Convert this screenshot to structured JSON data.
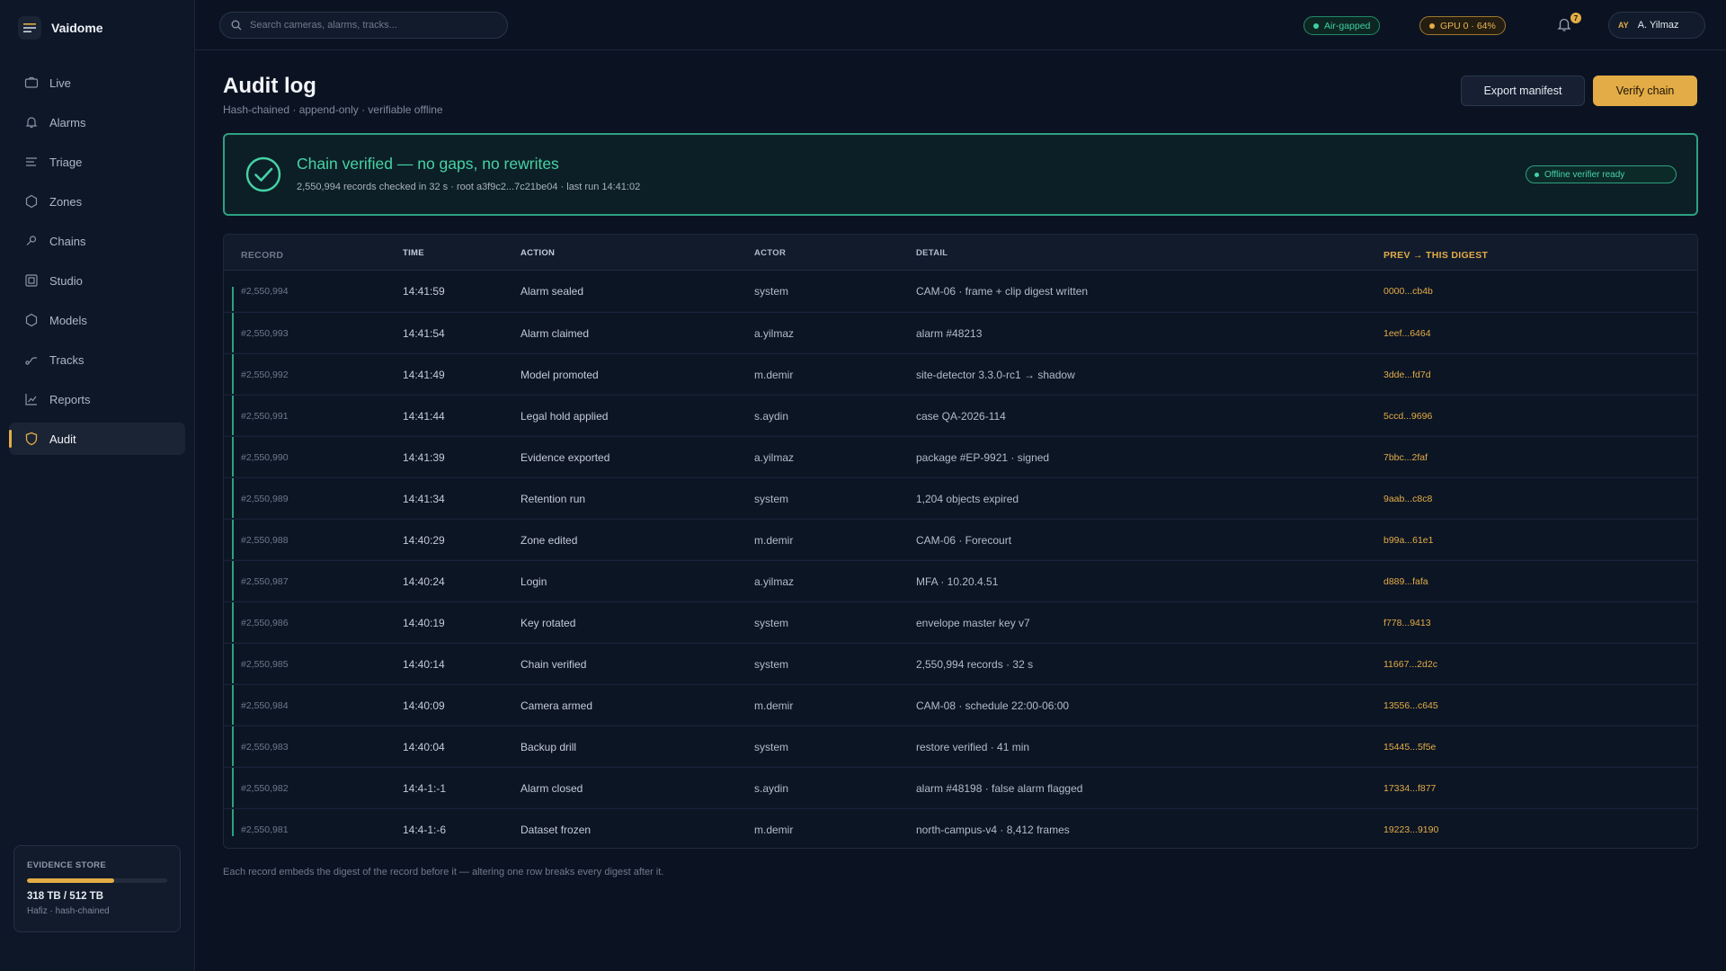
{
  "app": {
    "name": "Vaidome"
  },
  "sidebar": {
    "items": [
      {
        "label": "Live",
        "icon": "camera-icon"
      },
      {
        "label": "Alarms",
        "icon": "bell-icon"
      },
      {
        "label": "Triage",
        "icon": "list-icon"
      },
      {
        "label": "Zones",
        "icon": "hexagon-icon"
      },
      {
        "label": "Chains",
        "icon": "link-icon"
      },
      {
        "label": "Studio",
        "icon": "frame-icon"
      },
      {
        "label": "Models",
        "icon": "cube-icon"
      },
      {
        "label": "Tracks",
        "icon": "route-icon"
      },
      {
        "label": "Reports",
        "icon": "chart-icon"
      },
      {
        "label": "Audit",
        "icon": "shield-icon",
        "active": true
      }
    ],
    "store": {
      "title": "EVIDENCE STORE",
      "value": "318 TB / 512 TB",
      "sub": "Hafiz · hash-chained",
      "used_fraction": 0.62
    }
  },
  "topbar": {
    "search_placeholder": "Search cameras, alarms, tracks...",
    "air_gapped": "Air-gapped",
    "gpu": "GPU 0 · 64%",
    "notifications": "7",
    "user_initials": "AY",
    "user_name": "A. Yilmaz"
  },
  "page": {
    "title": "Audit log",
    "subtitle": "Hash-chained · append-only · verifiable offline",
    "export_label": "Export manifest",
    "verify_label": "Verify chain"
  },
  "banner": {
    "title": "Chain verified — no gaps, no rewrites",
    "subtitle": "2,550,994 records checked in 32 s · root a3f9c2...7c21be04 · last run 14:41:02",
    "badge": "Offline verifier ready"
  },
  "table": {
    "columns": [
      "RECORD",
      "TIME",
      "ACTION",
      "ACTOR",
      "DETAIL",
      "PREV → THIS DIGEST"
    ],
    "rows": [
      {
        "record": "#2,550,994",
        "time": "14:41:59",
        "action": "Alarm sealed",
        "actor": "system",
        "detail": "CAM-06 · frame + clip digest written",
        "digest": "0000...cb4b"
      },
      {
        "record": "#2,550,993",
        "time": "14:41:54",
        "action": "Alarm claimed",
        "actor": "a.yilmaz",
        "detail": "alarm #48213",
        "digest": "1eef...6464"
      },
      {
        "record": "#2,550,992",
        "time": "14:41:49",
        "action": "Model promoted",
        "actor": "m.demir",
        "detail": "site-detector 3.3.0-rc1 → shadow",
        "digest": "3dde...fd7d"
      },
      {
        "record": "#2,550,991",
        "time": "14:41:44",
        "action": "Legal hold applied",
        "actor": "s.aydin",
        "detail": "case QA-2026-114",
        "digest": "5ccd...9696"
      },
      {
        "record": "#2,550,990",
        "time": "14:41:39",
        "action": "Evidence exported",
        "actor": "a.yilmaz",
        "detail": "package #EP-9921 · signed",
        "digest": "7bbc...2faf"
      },
      {
        "record": "#2,550,989",
        "time": "14:41:34",
        "action": "Retention run",
        "actor": "system",
        "detail": "1,204 objects expired",
        "digest": "9aab...c8c8"
      },
      {
        "record": "#2,550,988",
        "time": "14:40:29",
        "action": "Zone edited",
        "actor": "m.demir",
        "detail": "CAM-06 · Forecourt",
        "digest": "b99a...61e1"
      },
      {
        "record": "#2,550,987",
        "time": "14:40:24",
        "action": "Login",
        "actor": "a.yilmaz",
        "detail": "MFA · 10.20.4.51",
        "digest": "d889...fafa"
      },
      {
        "record": "#2,550,986",
        "time": "14:40:19",
        "action": "Key rotated",
        "actor": "system",
        "detail": "envelope master key v7",
        "digest": "f778...9413"
      },
      {
        "record": "#2,550,985",
        "time": "14:40:14",
        "action": "Chain verified",
        "actor": "system",
        "detail": "2,550,994 records · 32 s",
        "digest": "11667...2d2c"
      },
      {
        "record": "#2,550,984",
        "time": "14:40:09",
        "action": "Camera armed",
        "actor": "m.demir",
        "detail": "CAM-08 · schedule 22:00-06:00",
        "digest": "13556...c645"
      },
      {
        "record": "#2,550,983",
        "time": "14:40:04",
        "action": "Backup drill",
        "actor": "system",
        "detail": "restore verified · 41 min",
        "digest": "15445...5f5e"
      },
      {
        "record": "#2,550,982",
        "time": "14:4-1:-1",
        "action": "Alarm closed",
        "actor": "s.aydin",
        "detail": "alarm #48198 · false alarm flagged",
        "digest": "17334...f877"
      },
      {
        "record": "#2,550,981",
        "time": "14:4-1:-6",
        "action": "Dataset frozen",
        "actor": "m.demir",
        "detail": "north-campus-v4 · 8,412 frames",
        "digest": "19223...9190"
      }
    ]
  },
  "footnote": "Each record embeds the digest of the record before it — altering one row breaks every digest after it."
}
